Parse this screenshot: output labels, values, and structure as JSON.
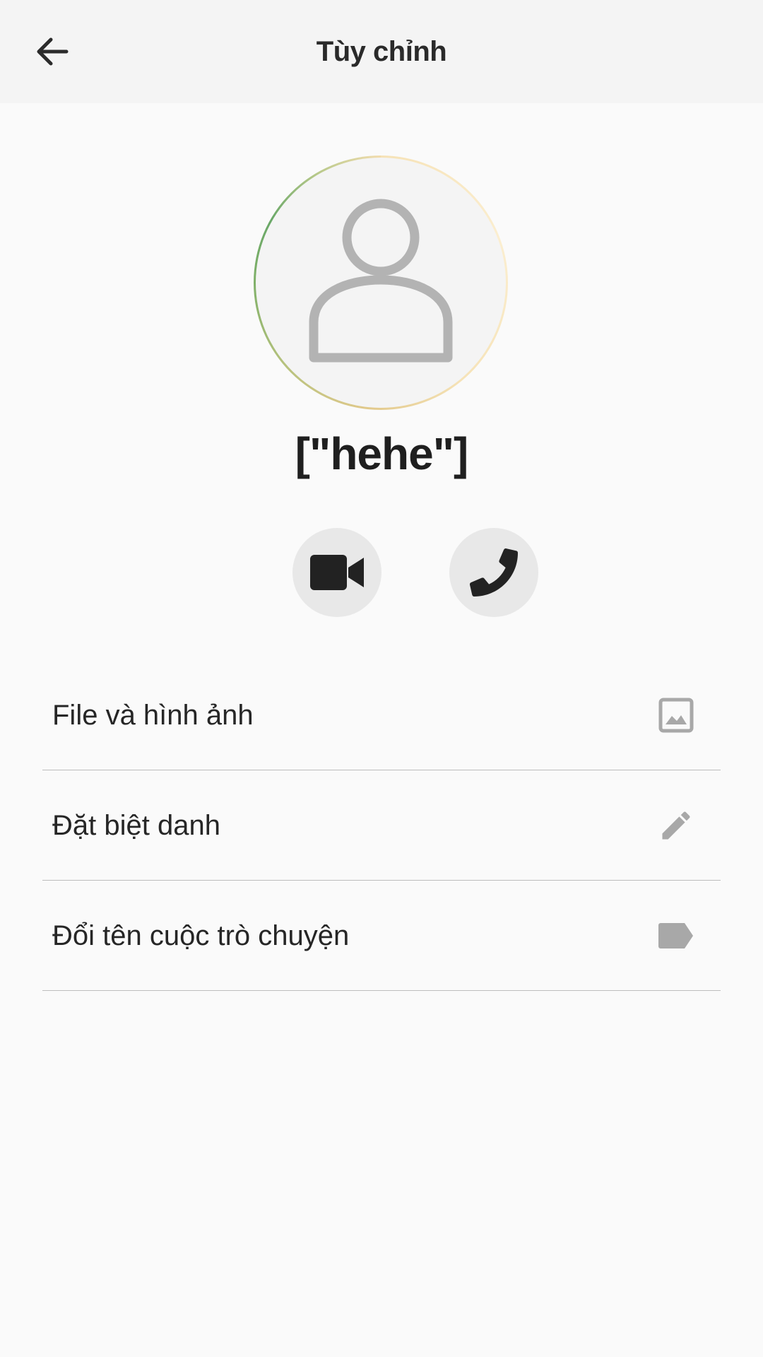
{
  "header": {
    "title": "Tùy chỉnh",
    "back_icon": "arrow-back-icon"
  },
  "profile": {
    "avatar_icon": "person-outline-icon",
    "name": "[\"hehe\"]"
  },
  "actions": {
    "video_icon": "video-camera-icon",
    "call_icon": "phone-icon"
  },
  "menu": {
    "items": [
      {
        "label": "File và hình ảnh",
        "icon": "image-icon"
      },
      {
        "label": "Đặt biệt danh",
        "icon": "pencil-icon"
      },
      {
        "label": "Đổi tên cuộc trò chuyện",
        "icon": "label-tag-icon"
      }
    ]
  },
  "colors": {
    "background": "#fafafa",
    "topbar": "#f4f4f4",
    "action_button_bg": "#e8e8e8",
    "menu_icon": "#a8a8a8",
    "divider": "#bdbdbd"
  }
}
